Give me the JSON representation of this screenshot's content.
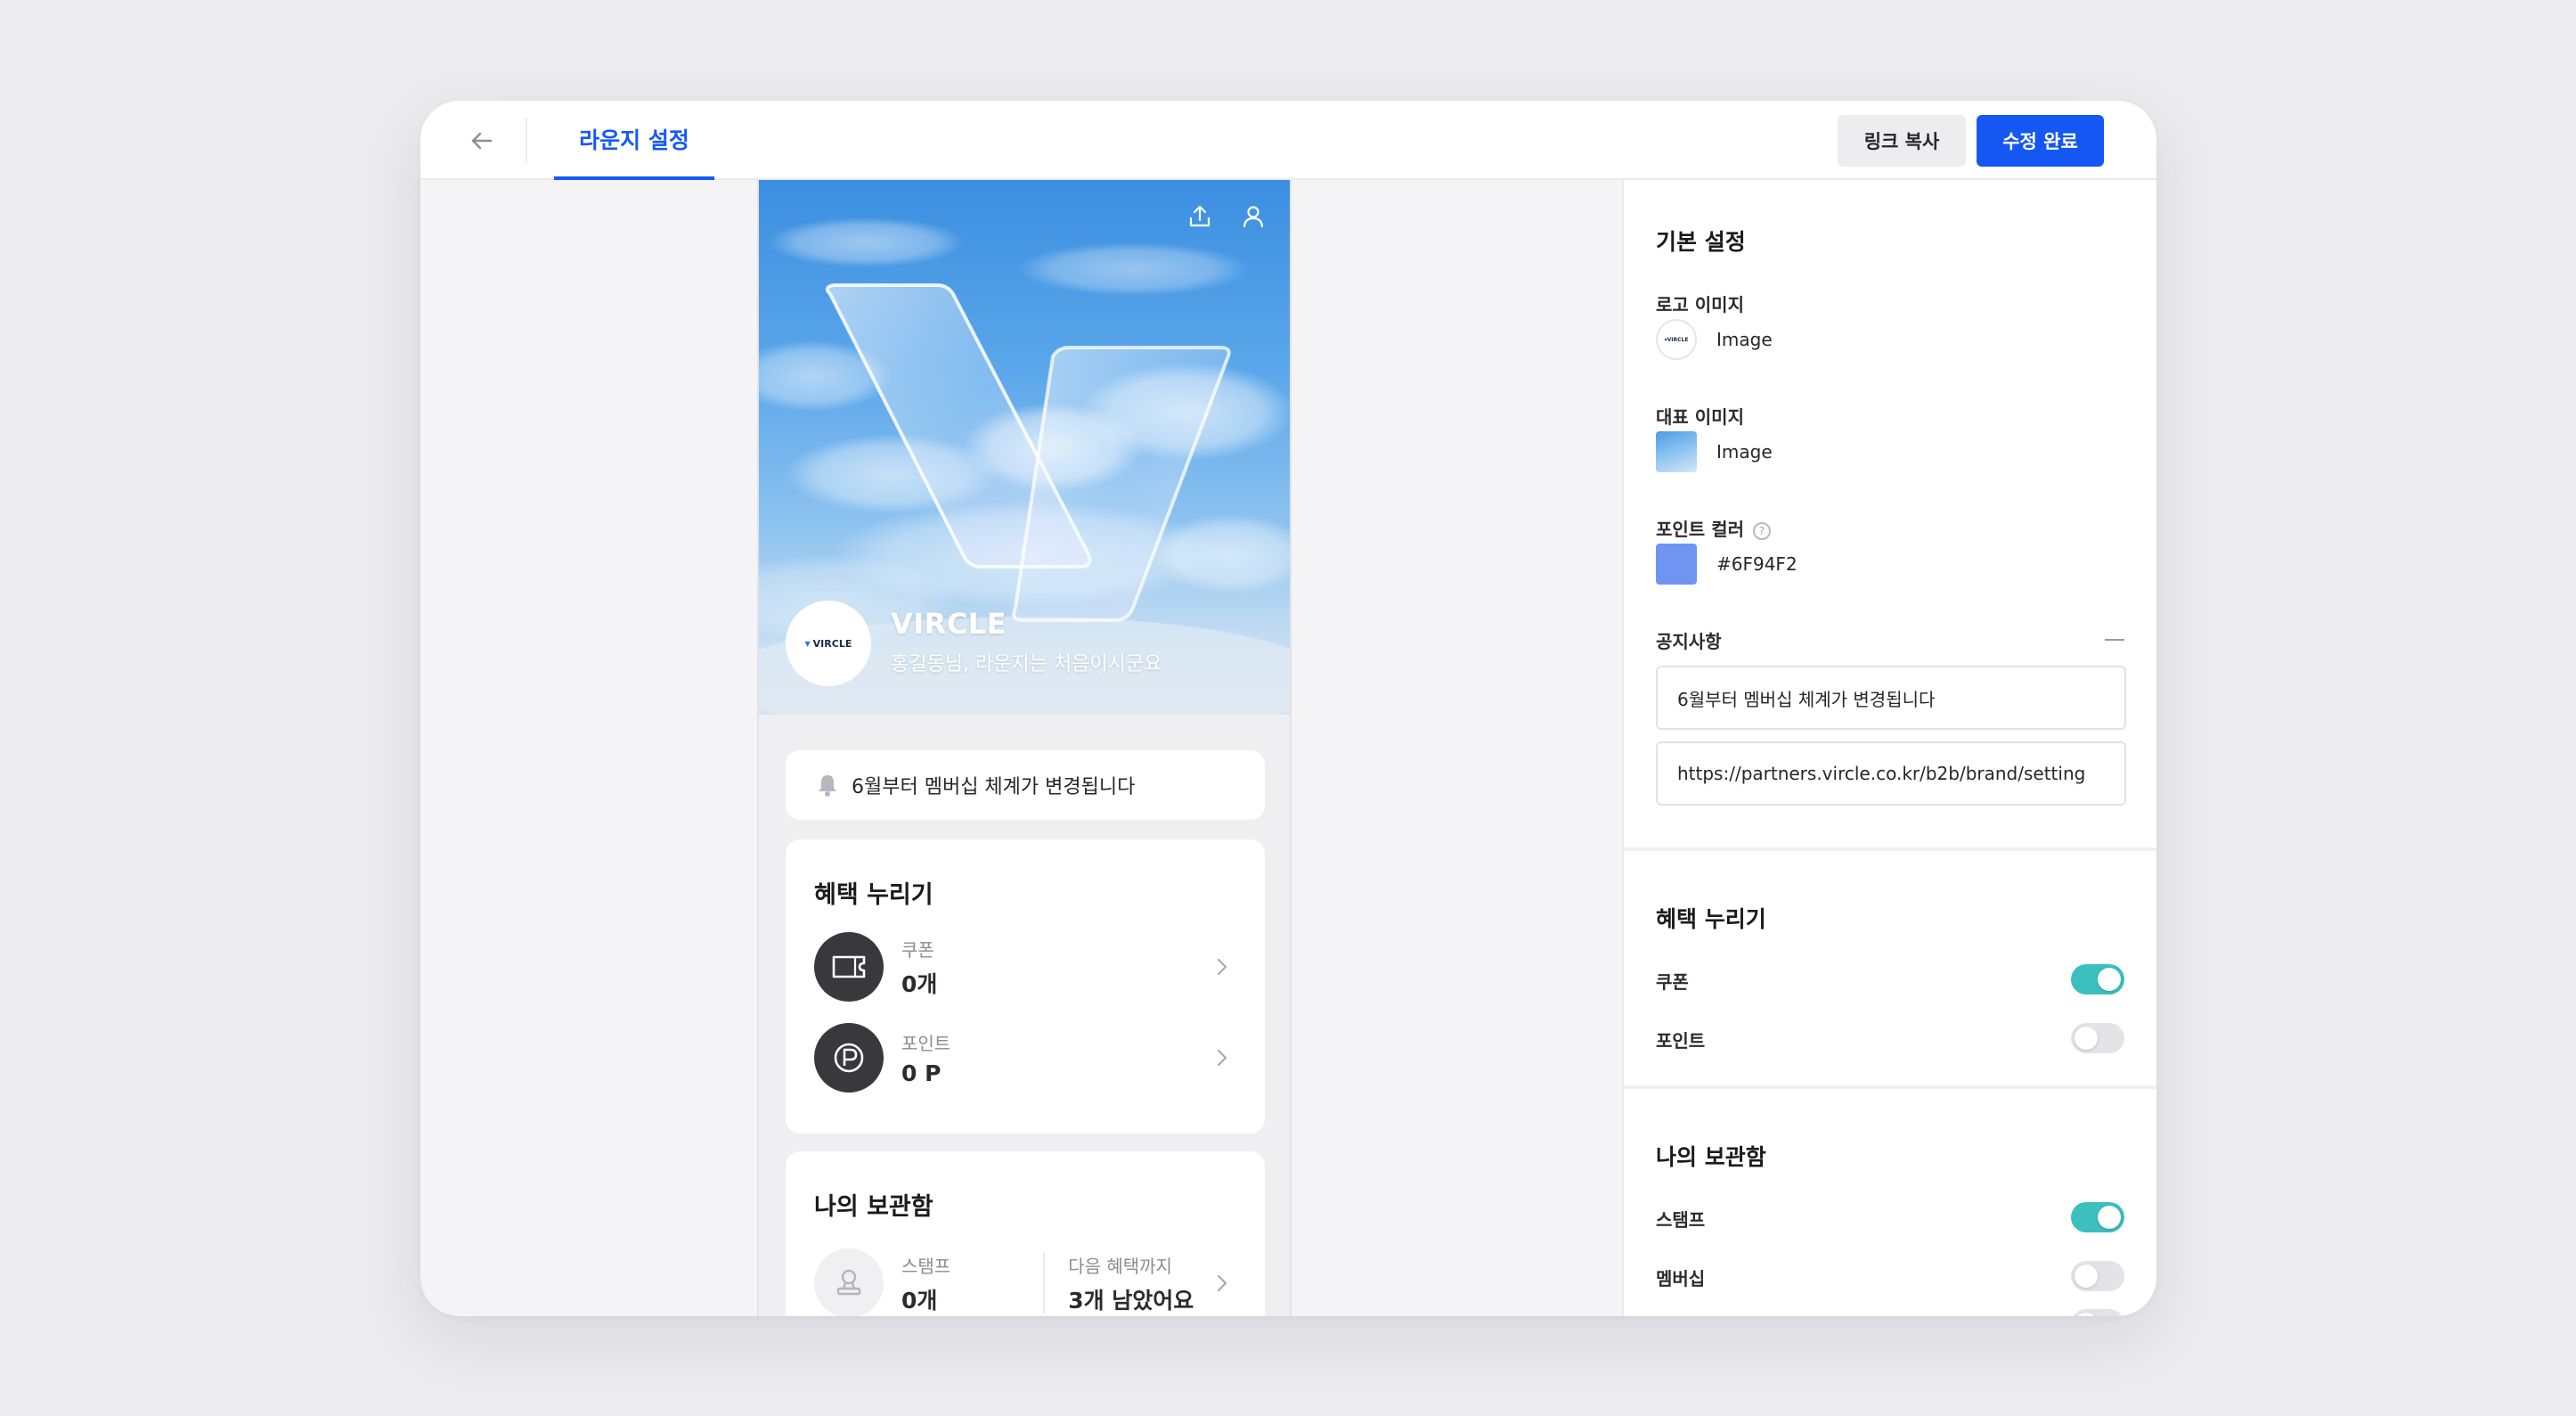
{
  "header": {
    "tab_active": "라운지 설정",
    "copy_link": "링크 복사",
    "save_done": "수정 완료"
  },
  "preview": {
    "brand_name": "VIRCLE",
    "greeting": "홍길동님, 라운지는 처음이시군요",
    "logo_text": "VIRCLE",
    "notice": "6월부터 멤버십 체계가 변경됩니다",
    "benefits": {
      "title": "혜택 누리기",
      "coupon_label": "쿠폰",
      "coupon_value": "0개",
      "point_label": "포인트",
      "point_value": "0 P"
    },
    "storage": {
      "title": "나의 보관함",
      "stamp_label": "스탬프",
      "stamp_value": "0개",
      "next_label": "다음 혜택까지",
      "next_value": "3개 남았어요"
    }
  },
  "panel": {
    "basic": {
      "title": "기본 설정",
      "logo_label": "로고 이미지",
      "logo_value": "Image",
      "main_image_label": "대표 이미지",
      "main_image_value": "Image",
      "point_color_label": "포인트 컬러",
      "point_color_value": "#6F94F2",
      "notice_label": "공지사항",
      "notice_text": "6월부터 멤버십 체계가 변경됩니다",
      "notice_url": "https://partners.vircle.co.kr/b2b/brand/setting"
    },
    "benefits": {
      "title": "혜택 누리기",
      "coupon": "쿠폰",
      "coupon_on": true,
      "point": "포인트",
      "point_on": false
    },
    "storage": {
      "title": "나의 보관함",
      "stamp": "스탬프",
      "stamp_on": true,
      "membership": "멤버십",
      "membership_on": false
    }
  },
  "colors": {
    "accent": "#1457F2",
    "point_color": "#6F94F2",
    "toggle_on": "#3BBFBF"
  }
}
